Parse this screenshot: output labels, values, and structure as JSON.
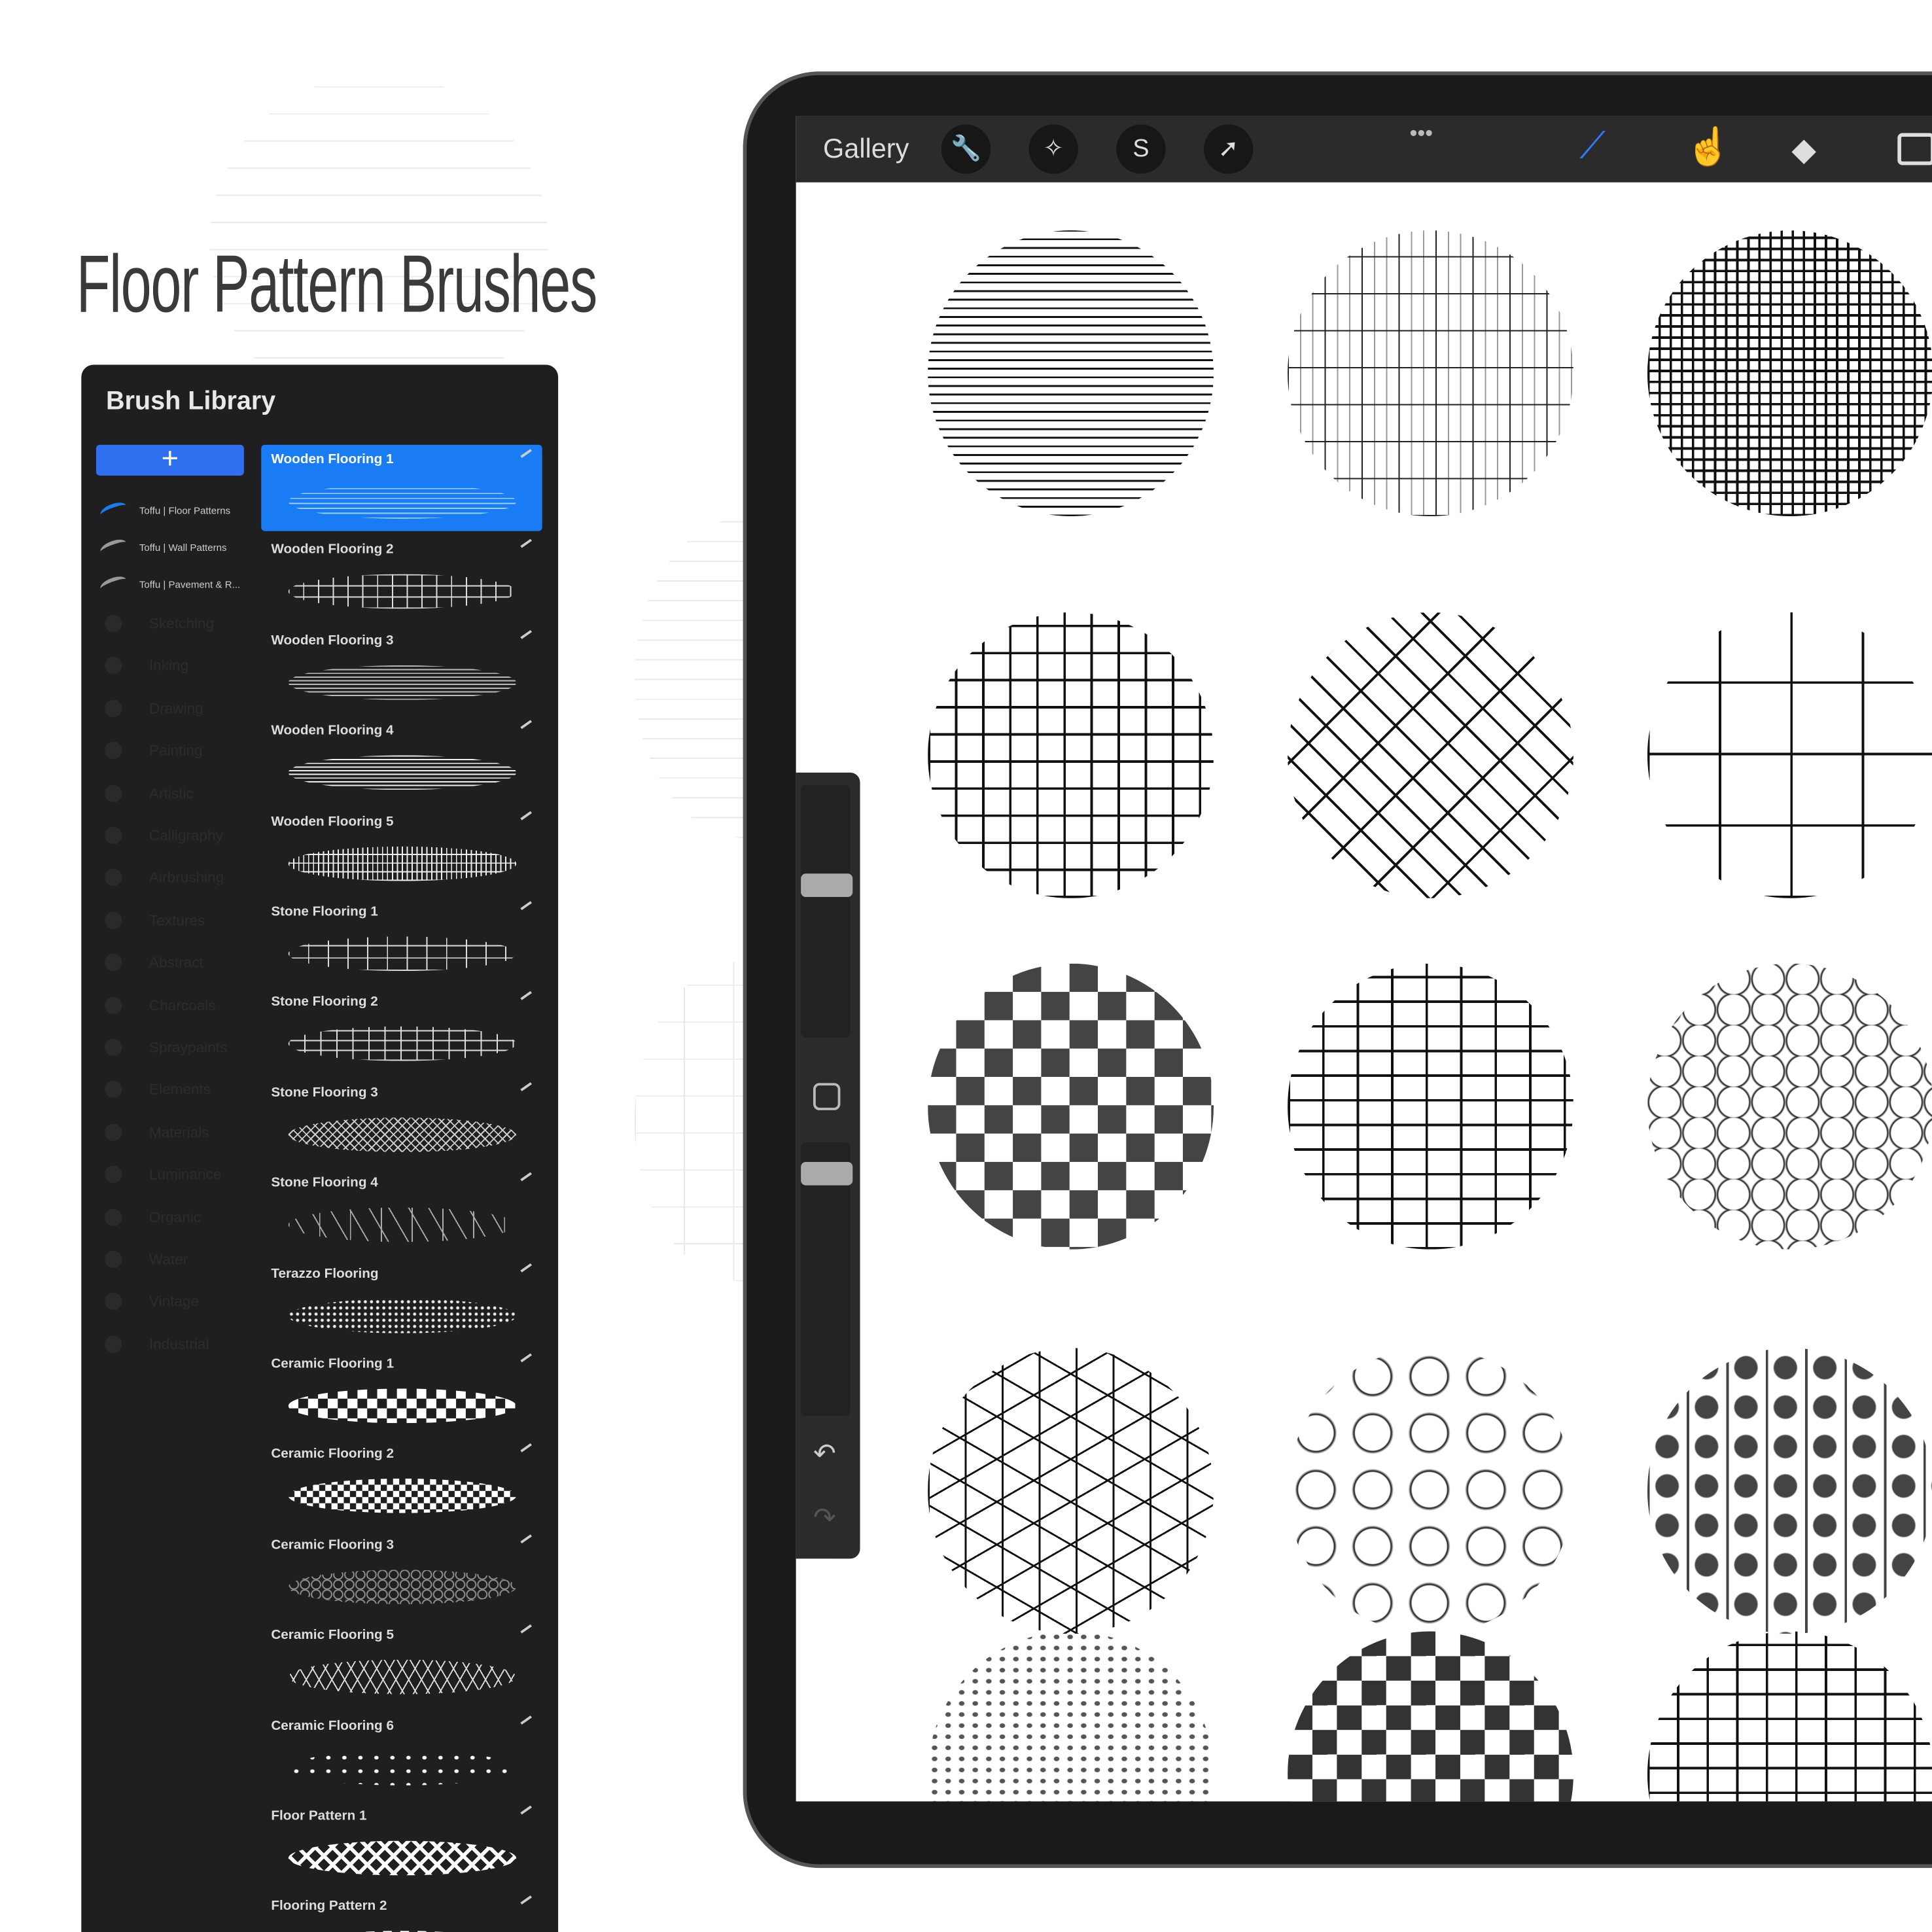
{
  "page_title": "Floor Pattern Brushes",
  "brush_library": {
    "title": "Brush Library",
    "add_label": "+",
    "sets": [
      {
        "label": "Toffu | Floor Patterns",
        "active": true
      },
      {
        "label": "Toffu | Wall Patterns"
      },
      {
        "label": "Toffu | Pavement & R..."
      }
    ],
    "default_sets": [
      "Sketching",
      "Inking",
      "Drawing",
      "Painting",
      "Artistic",
      "Calligraphy",
      "Airbrushing",
      "Textures",
      "Abstract",
      "Charcoals",
      "Spraypaints",
      "Elements",
      "Materials",
      "Luminance",
      "Organic",
      "Water",
      "Vintage",
      "Industrial"
    ],
    "brushes": [
      "Wooden Flooring 1",
      "Wooden Flooring 2",
      "Wooden Flooring 3",
      "Wooden Flooring 4",
      "Wooden Flooring 5",
      "Stone Flooring 1",
      "Stone Flooring 2",
      "Stone Flooring 3",
      "Stone Flooring 4",
      "Terazzo Flooring",
      "Ceramic Flooring 1",
      "Ceramic Flooring 2",
      "Ceramic Flooring 3",
      "Ceramic Flooring 5",
      "Ceramic Flooring 6",
      "Floor Pattern 1",
      "Flooring Pattern 2"
    ],
    "selected_brush": "Wooden Flooring 1"
  },
  "toolbar": {
    "gallery": "Gallery",
    "more": "•••",
    "tools": [
      "wrench-icon",
      "magic-wand-icon",
      "selection-icon",
      "transform-arrow-icon"
    ],
    "right_tools": [
      "brush-icon",
      "smudge-icon",
      "eraser-icon",
      "layers-icon"
    ]
  },
  "colors": {
    "accent": "#1a7cf5",
    "panel": "#1f1f1f",
    "toolbar": "#2b2b2b"
  }
}
